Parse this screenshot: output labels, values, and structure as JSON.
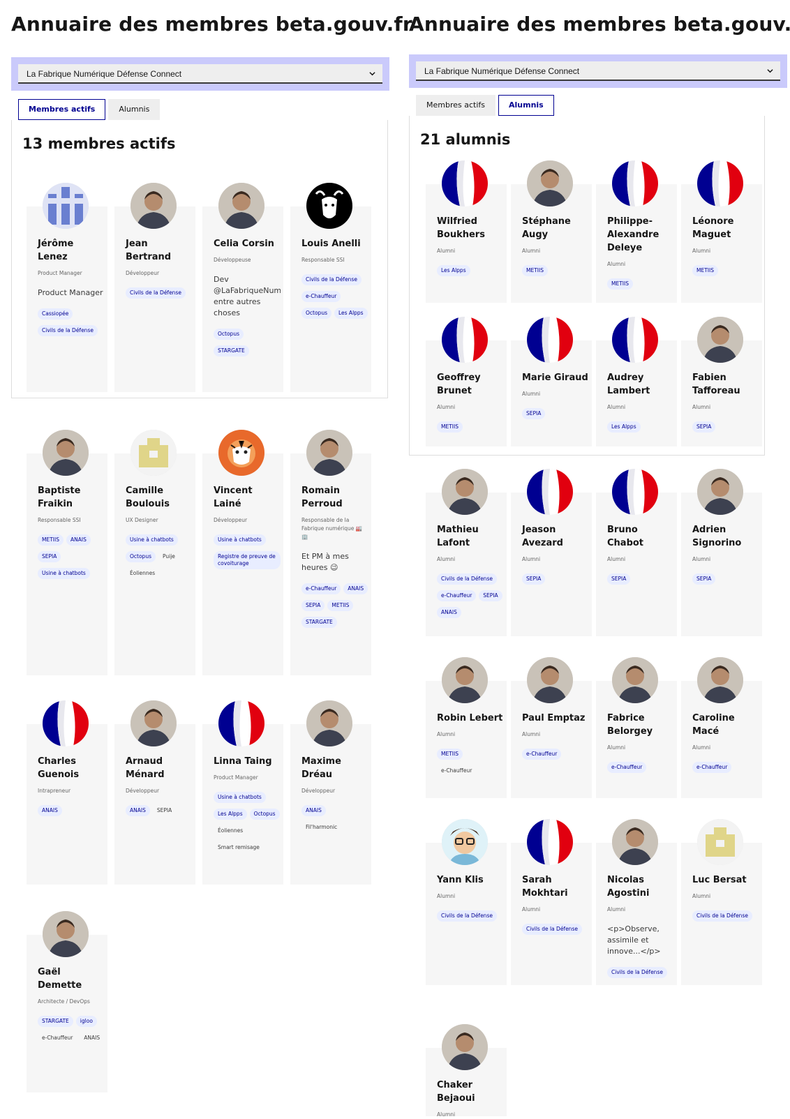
{
  "left": {
    "title": "Annuaire des membres beta.gouv.fr",
    "select_value": "La Fabrique Numérique Défense Connect",
    "tabs": [
      {
        "label": "Membres actifs"
      },
      {
        "label": "Alumnis"
      }
    ],
    "count": "13 membres actifs",
    "members": [
      {
        "name": "Jérôme Lenez",
        "role": "Product Manager",
        "bio": "Product Manager",
        "avatar": "stripes-blue",
        "tags": [
          {
            "t": "Cassiopée",
            "tone": "blue"
          },
          {
            "t": "Civils de la Défense",
            "tone": "blue"
          }
        ]
      },
      {
        "name": "Jean Bertrand",
        "role": "Développeur",
        "bio": "",
        "avatar": "photo",
        "tags": [
          {
            "t": "Civils de la Défense",
            "tone": "blue"
          }
        ]
      },
      {
        "name": "Celia Corsin",
        "role": "Développeuse",
        "bio": "Dev @LaFabriqueNumérique entre autres choses",
        "avatar": "photo",
        "tags": [
          {
            "t": "Octopus",
            "tone": "blue"
          },
          {
            "t": "STARGATE",
            "tone": "blue"
          }
        ]
      },
      {
        "name": "Louis Anelli",
        "role": "Responsable SSI",
        "bio": "",
        "avatar": "gnu-logo",
        "tags": [
          {
            "t": "Civils de la Défense",
            "tone": "blue"
          },
          {
            "t": "e-Chauffeur",
            "tone": "blue"
          },
          {
            "t": "Octopus",
            "tone": "blue"
          },
          {
            "t": "Les Alpps",
            "tone": "blue"
          }
        ]
      },
      {
        "name": "Baptiste Fraikin",
        "role": "Responsable SSI",
        "bio": "",
        "avatar": "photo",
        "tags": [
          {
            "t": "METIIS",
            "tone": "blue"
          },
          {
            "t": "ANAIS",
            "tone": "blue"
          },
          {
            "t": "SEPIA",
            "tone": "blue"
          },
          {
            "t": "Usine à chatbots",
            "tone": "blue"
          }
        ]
      },
      {
        "name": "Camille Boulouis",
        "role": "UX Designer",
        "bio": "",
        "avatar": "yellow-blocks",
        "tags": [
          {
            "t": "Usine à chatbots",
            "tone": "blue"
          },
          {
            "t": "Octopus",
            "tone": "blue"
          },
          {
            "t": "Puije",
            "tone": "plain"
          },
          {
            "t": "Éoliennes",
            "tone": "plain"
          }
        ]
      },
      {
        "name": "Vincent Lainé",
        "role": "Développeur",
        "bio": "",
        "avatar": "tiger",
        "tags": [
          {
            "t": "Usine à chatbots",
            "tone": "blue"
          },
          {
            "t": "Registre de preuve de covoiturage",
            "tone": "blue"
          }
        ]
      },
      {
        "name": "Romain Perroud",
        "role": "Responsable de la Fabrique numérique 🏭🏢",
        "bio": "Et PM à mes heures 😉",
        "avatar": "photo",
        "tags": [
          {
            "t": "e-Chauffeur",
            "tone": "blue"
          },
          {
            "t": "ANAIS",
            "tone": "blue"
          },
          {
            "t": "SEPIA",
            "tone": "blue"
          },
          {
            "t": "METIIS",
            "tone": "blue"
          },
          {
            "t": "STARGATE",
            "tone": "blue"
          }
        ]
      },
      {
        "name": "Charles Guenois",
        "role": "Intrapreneur",
        "bio": "",
        "avatar": "flag",
        "tags": [
          {
            "t": "ANAIS",
            "tone": "blue"
          }
        ]
      },
      {
        "name": "Arnaud Ménard",
        "role": "Développeur",
        "bio": "",
        "avatar": "photo",
        "tags": [
          {
            "t": "ANAIS",
            "tone": "blue"
          },
          {
            "t": "SEPIA",
            "tone": "plain"
          }
        ]
      },
      {
        "name": "Linna Taing",
        "role": "Product Manager",
        "bio": "",
        "avatar": "flag",
        "tags": [
          {
            "t": "Usine à chatbots",
            "tone": "blue"
          },
          {
            "t": "Les Alpps",
            "tone": "blue"
          },
          {
            "t": "Octopus",
            "tone": "blue"
          },
          {
            "t": "Éoliennes",
            "tone": "plain"
          },
          {
            "t": "Smart remisage",
            "tone": "plain"
          }
        ]
      },
      {
        "name": "Maxime Dréau",
        "role": "Développeur",
        "bio": "",
        "avatar": "photo",
        "tags": [
          {
            "t": "ANAIS",
            "tone": "blue"
          },
          {
            "t": "Fil'harmonic",
            "tone": "plain"
          }
        ]
      },
      {
        "name": "Gaël Demette",
        "role": "Architecte / DevOps",
        "bio": "",
        "avatar": "photo",
        "tags": [
          {
            "t": "STARGATE",
            "tone": "blue"
          },
          {
            "t": "igloo",
            "tone": "blue"
          },
          {
            "t": "e-Chauffeur",
            "tone": "plain"
          },
          {
            "t": "ANAIS",
            "tone": "plain"
          }
        ]
      }
    ]
  },
  "right": {
    "title": "Annuaire des membres beta.gouv.fr",
    "select_value": "La Fabrique Numérique Défense Connect",
    "tabs": [
      {
        "label": "Membres actifs"
      },
      {
        "label": "Alumnis"
      }
    ],
    "count": "21 alumnis",
    "members": [
      {
        "name": "Wilfried Boukhers",
        "role": "Alumni",
        "avatar": "flag",
        "tags": [
          {
            "t": "Les Alpps",
            "tone": "blue"
          }
        ]
      },
      {
        "name": "Stéphane Augy",
        "role": "Alumni",
        "avatar": "photo",
        "tags": [
          {
            "t": "METIIS",
            "tone": "blue"
          }
        ]
      },
      {
        "name": "Philippe-Alexandre Deleye",
        "role": "Alumni",
        "avatar": "flag",
        "tags": [
          {
            "t": "METIIS",
            "tone": "blue"
          }
        ]
      },
      {
        "name": "Léonore Maguet",
        "role": "Alumni",
        "avatar": "flag",
        "tags": [
          {
            "t": "METIIS",
            "tone": "blue"
          }
        ]
      },
      {
        "name": "Geoffrey Brunet",
        "role": "Alumni",
        "avatar": "flag",
        "tags": [
          {
            "t": "METIIS",
            "tone": "blue"
          }
        ]
      },
      {
        "name": "Marie Giraud",
        "role": "Alumni",
        "avatar": "flag",
        "tags": [
          {
            "t": "SEPIA",
            "tone": "blue"
          }
        ]
      },
      {
        "name": "Audrey Lambert",
        "role": "Alumni",
        "avatar": "flag",
        "tags": [
          {
            "t": "Les Alpps",
            "tone": "blue"
          }
        ]
      },
      {
        "name": "Fabien Tafforeau",
        "role": "Alumni",
        "avatar": "photo",
        "tags": [
          {
            "t": "SEPIA",
            "tone": "blue"
          }
        ]
      },
      {
        "name": "Mathieu Lafont",
        "role": "Alumni",
        "avatar": "photo",
        "tags": [
          {
            "t": "Civils de la Défense",
            "tone": "blue"
          },
          {
            "t": "e-Chauffeur",
            "tone": "blue"
          },
          {
            "t": "SEPIA",
            "tone": "blue"
          },
          {
            "t": "ANAIS",
            "tone": "blue"
          }
        ]
      },
      {
        "name": "Jeason Avezard",
        "role": "Alumni",
        "avatar": "flag",
        "tags": [
          {
            "t": "SEPIA",
            "tone": "blue"
          }
        ]
      },
      {
        "name": "Bruno Chabot",
        "role": "Alumni",
        "avatar": "flag",
        "tags": [
          {
            "t": "SEPIA",
            "tone": "blue"
          }
        ]
      },
      {
        "name": "Adrien Signorino",
        "role": "Alumni",
        "avatar": "photo",
        "tags": [
          {
            "t": "SEPIA",
            "tone": "blue"
          }
        ]
      },
      {
        "name": "Robin Lebert",
        "role": "Alumni",
        "avatar": "photo",
        "tags": [
          {
            "t": "METIIS",
            "tone": "blue"
          },
          {
            "t": "e-Chauffeur",
            "tone": "plain"
          }
        ]
      },
      {
        "name": "Paul Emptaz",
        "role": "Alumni",
        "avatar": "photo",
        "tags": [
          {
            "t": "e-Chauffeur",
            "tone": "blue"
          }
        ]
      },
      {
        "name": "Fabrice Belorgey",
        "role": "Alumni",
        "avatar": "photo",
        "tags": [
          {
            "t": "e-Chauffeur",
            "tone": "blue"
          }
        ]
      },
      {
        "name": "Caroline Macé",
        "role": "Alumni",
        "avatar": "photo",
        "tags": [
          {
            "t": "e-Chauffeur",
            "tone": "blue"
          }
        ]
      },
      {
        "name": "Yann Klis",
        "role": "Alumni",
        "avatar": "cartoon",
        "tags": [
          {
            "t": "Civils de la Défense",
            "tone": "blue"
          }
        ]
      },
      {
        "name": "Sarah Mokhtari",
        "role": "Alumni",
        "avatar": "flag",
        "tags": [
          {
            "t": "Civils de la Défense",
            "tone": "blue"
          }
        ]
      },
      {
        "name": "Nicolas Agostini",
        "role": "Alumni",
        "bio": "<p>Observe, assimile et innove...</p>",
        "avatar": "photo",
        "tags": [
          {
            "t": "Civils de la Défense",
            "tone": "blue"
          }
        ]
      },
      {
        "name": "Luc Bersat",
        "role": "Alumni",
        "avatar": "yellow-blocks",
        "tags": [
          {
            "t": "Civils de la Défense",
            "tone": "blue"
          }
        ]
      },
      {
        "name": "Chaker Bejaoui",
        "role": "Alumni",
        "avatar": "photo",
        "tags": []
      }
    ]
  },
  "colors": {
    "accent": "#000091",
    "select_band": "#cacafb",
    "tag_bg": "#e8edff",
    "card_bg": "#f6f6f6",
    "flag_blue": "#000091",
    "flag_red": "#e1000f"
  },
  "icons": {
    "select": "chevron-down-icon"
  }
}
